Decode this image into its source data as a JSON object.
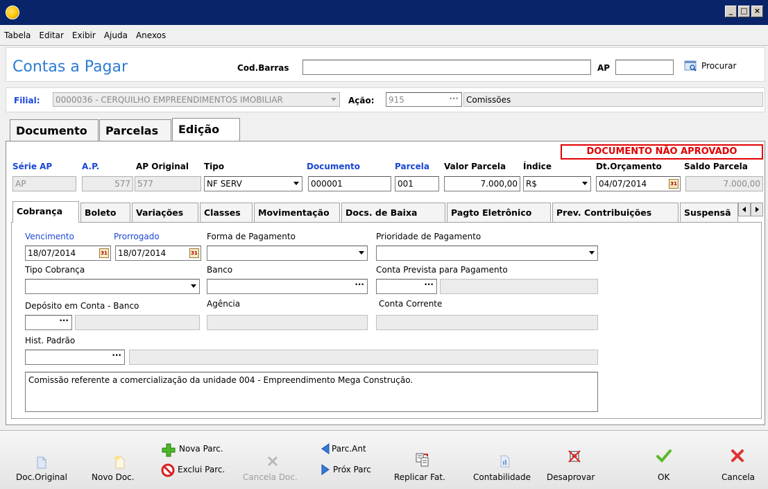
{
  "window": {
    "minimize": "_",
    "maximize": "□",
    "close": "×"
  },
  "menu": [
    "Tabela",
    "Editar",
    "Exibir",
    "Ajuda",
    "Anexos"
  ],
  "header": {
    "title": "Contas a Pagar",
    "barcode_label": "Cod.Barras",
    "barcode_value": "",
    "ap_label": "AP",
    "ap_value": "",
    "search_label": "Procurar"
  },
  "filial": {
    "label": "Filial:",
    "value": "0000036 - CERQUILHO EMPREENDIMENTOS IMOBILIAR",
    "acao_label": "Ação:",
    "acao_code": "915",
    "acao_desc": "Comissões"
  },
  "main_tabs": [
    "Documento",
    "Parcelas",
    "Edição"
  ],
  "status": "DOCUMENTO NÃO APROVADO",
  "doc_fields": {
    "serie_label": "Série AP",
    "serie_value": "AP",
    "ap_label": "A.P.",
    "ap_value": "577",
    "ap_original_label": "AP Original",
    "ap_original_value": "577",
    "tipo_label": "Tipo",
    "tipo_value": "NF SERV",
    "documento_label": "Documento",
    "documento_value": "000001",
    "parcela_label": "Parcela",
    "parcela_value": "001",
    "valor_label": "Valor Parcela",
    "valor_value": "7.000,00",
    "indice_label": "Índice",
    "indice_value": "R$",
    "dt_orc_label": "Dt.Orçamento",
    "dt_orc_value": "04/07/2014",
    "saldo_label": "Saldo Parcela",
    "saldo_value": "7.000,00"
  },
  "sub_tabs": [
    "Cobrança",
    "Boleto",
    "Variações",
    "Classes",
    "Movimentação",
    "Docs. de Baixa",
    "Pagto Eletrônico",
    "Prev. Contribuições",
    "Suspensã"
  ],
  "cobranca": {
    "vencimento_label": "Vencimento",
    "vencimento_value": "18/07/2014",
    "prorrogado_label": "Prorrogado",
    "prorrogado_value": "18/07/2014",
    "forma_label": "Forma de Pagamento",
    "forma_value": "",
    "prioridade_label": "Prioridade de Pagamento",
    "prioridade_value": "",
    "tipo_cobranca_label": "Tipo Cobrança",
    "tipo_cobranca_value": "",
    "banco_label": "Banco",
    "banco_value": "",
    "conta_prevista_label": "Conta Prevista para Pagamento",
    "conta_prevista_value": "",
    "deposito_label": "Depósito em Conta - Banco",
    "agencia_label": "Agência",
    "conta_corrente_label": "Conta Corrente",
    "hist_label": "Hist. Padrão",
    "observacao": "Comissão referente a comercialização da unidade 004 - Empreendimento Mega Construção."
  },
  "toolbar": {
    "doc_original": "Doc.Original",
    "novo_doc": "Novo Doc.",
    "nova_parc": "Nova Parc.",
    "exclui_parc": "Exclui Parc.",
    "cancela_doc": "Cancela Doc.",
    "parc_ant": "Parc.Ant",
    "prox_parc": "Próx Parc",
    "replicar_fat": "Replicar Fat.",
    "contabilidade": "Contabilidade",
    "desaprovar": "Desaprovar",
    "ok": "OK",
    "cancela": "Cancela"
  },
  "colors": {
    "title_blue": "#2b7bd4",
    "label_blue": "#1a46d6",
    "status_red": "#e00000",
    "ok_green": "#5cb82a",
    "cancel_red": "#e03030"
  }
}
